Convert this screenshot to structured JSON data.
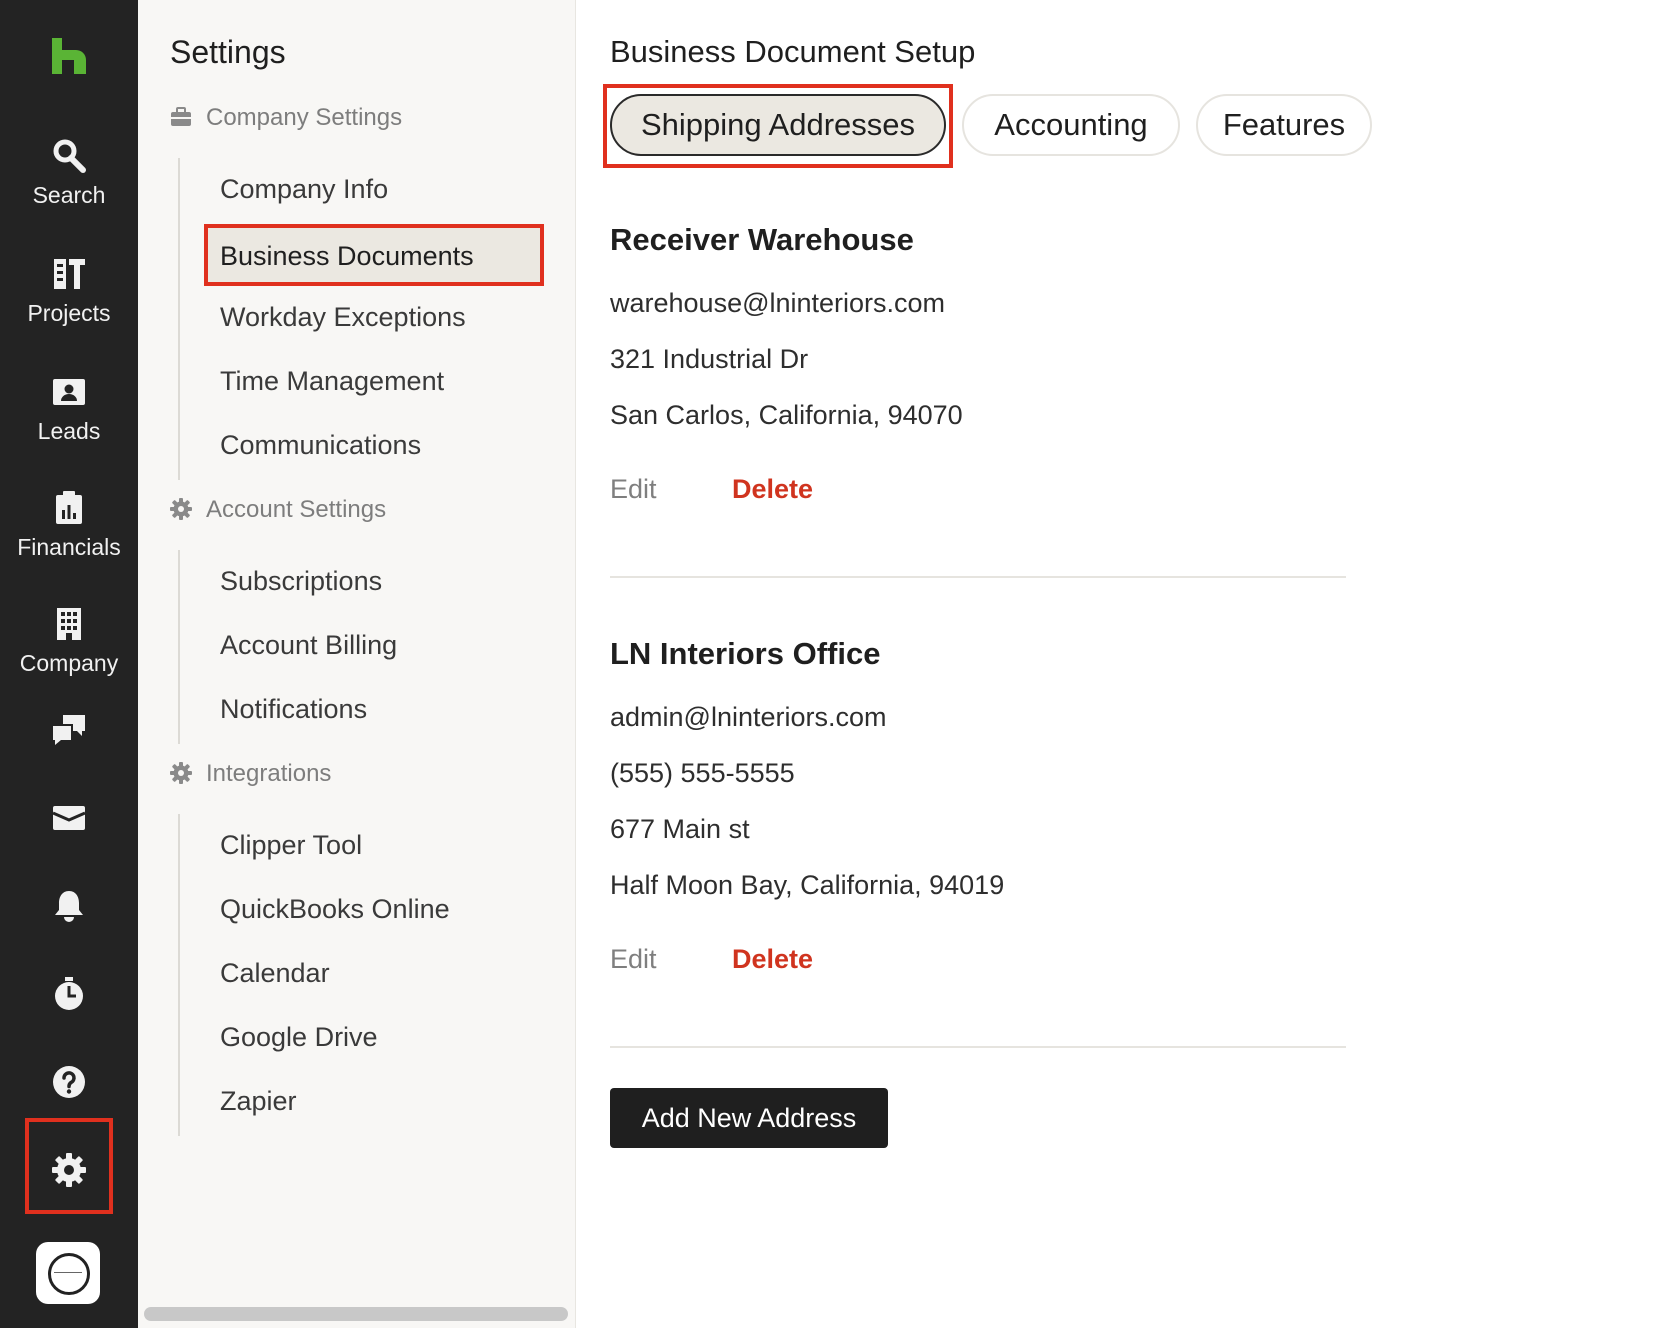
{
  "rail": {
    "items": [
      {
        "label": "Search",
        "icon": "search-icon"
      },
      {
        "label": "Projects",
        "icon": "projects-icon"
      },
      {
        "label": "Leads",
        "icon": "leads-icon"
      },
      {
        "label": "Financials",
        "icon": "financials-icon"
      },
      {
        "label": "Company",
        "icon": "company-icon"
      }
    ],
    "icons": [
      "chat-icon",
      "inbox-icon",
      "bell-icon",
      "timer-icon",
      "help-icon",
      "gear-icon"
    ],
    "brand_color": "#5ab435",
    "highlight_color": "#e0301e"
  },
  "sidebar": {
    "title": "Settings",
    "groups": [
      {
        "label": "Company Settings",
        "icon": "briefcase-icon",
        "items": [
          "Company Info",
          "Business Documents",
          "Workday Exceptions",
          "Time Management",
          "Communications"
        ]
      },
      {
        "label": "Account Settings",
        "icon": "gear-icon",
        "items": [
          "Subscriptions",
          "Account Billing",
          "Notifications"
        ]
      },
      {
        "label": "Integrations",
        "icon": "gear-icon",
        "items": [
          "Clipper Tool",
          "QuickBooks Online",
          "Calendar",
          "Google Drive",
          "Zapier"
        ]
      }
    ],
    "active_item": "Business Documents"
  },
  "main": {
    "title": "Business Document Setup",
    "tabs": [
      {
        "label": "Shipping Addresses",
        "active": true
      },
      {
        "label": "Accounting",
        "active": false
      },
      {
        "label": "Features",
        "active": false
      }
    ],
    "addresses": [
      {
        "name": "Receiver Warehouse",
        "lines": [
          "warehouse@lninteriors.com",
          "321 Industrial Dr",
          "San Carlos, California, 94070"
        ]
      },
      {
        "name": "LN Interiors Office",
        "lines": [
          "admin@lninteriors.com",
          "(555) 555-5555",
          "677 Main st",
          "Half Moon Bay, California, 94019"
        ]
      }
    ],
    "edit_label": "Edit",
    "delete_label": "Delete",
    "add_button_label": "Add New Address"
  }
}
